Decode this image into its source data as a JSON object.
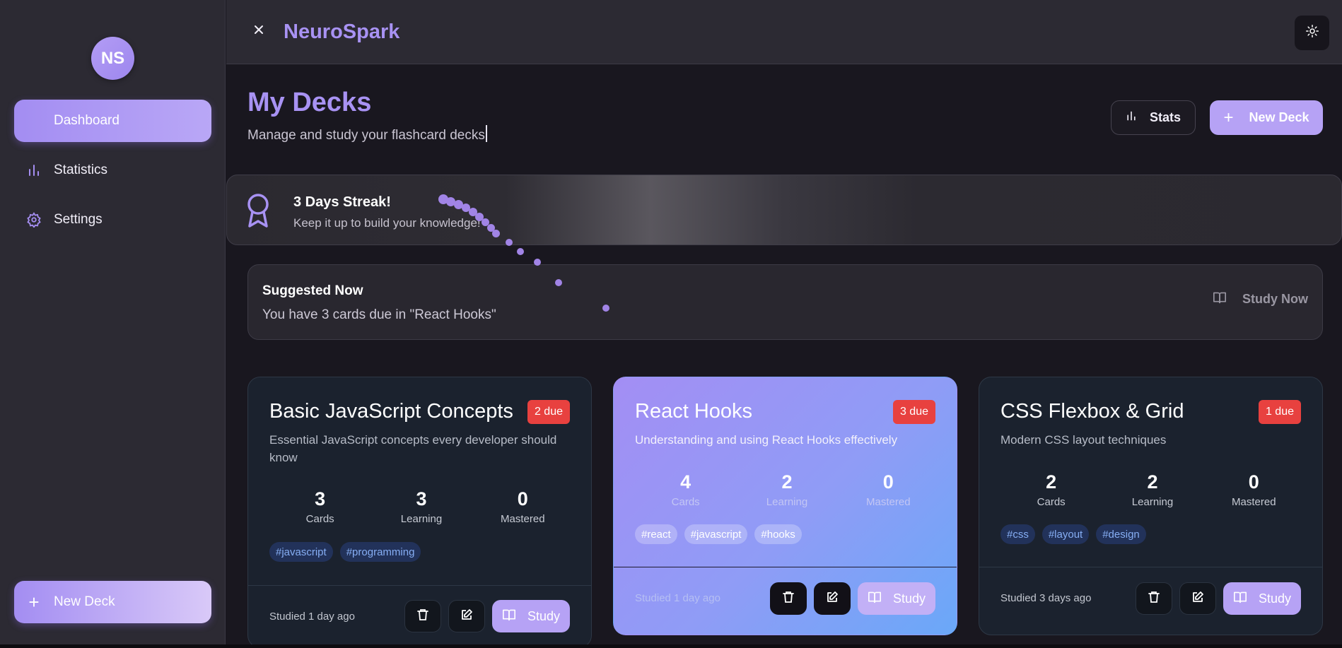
{
  "sidebar": {
    "avatar_initials": "NS",
    "items": [
      {
        "label": "Dashboard",
        "icon": "home-icon"
      },
      {
        "label": "Statistics",
        "icon": "bar-chart-icon"
      },
      {
        "label": "Settings",
        "icon": "gear-icon"
      }
    ],
    "new_deck_label": "New Deck"
  },
  "topbar": {
    "brand": "NeuroSpark",
    "close_icon": "close-icon",
    "theme_icon": "sun-icon"
  },
  "header": {
    "title": "My Decks",
    "subtitle": "Manage and study your flashcard decks",
    "stats_label": "Stats",
    "new_deck_label": "New Deck"
  },
  "streak": {
    "title": "3 Days Streak!",
    "text": "Keep it up to build your knowledge!"
  },
  "suggested": {
    "title": "Suggested Now",
    "text": "You have 3 cards due in \"React Hooks\"",
    "button_label": "Study Now"
  },
  "decks": [
    {
      "title": "Basic JavaScript Concepts",
      "description": "Essential JavaScript concepts every developer should know",
      "due": "2 due",
      "stats": [
        {
          "value": "3",
          "label": "Cards"
        },
        {
          "value": "3",
          "label": "Learning"
        },
        {
          "value": "0",
          "label": "Mastered"
        }
      ],
      "tags": [
        "#javascript",
        "#programming"
      ],
      "studied": "Studied 1 day ago",
      "study_label": "Study"
    },
    {
      "title": "React Hooks",
      "description": "Understanding and using React Hooks effectively",
      "due": "3 due",
      "stats": [
        {
          "value": "4",
          "label": "Cards"
        },
        {
          "value": "2",
          "label": "Learning"
        },
        {
          "value": "0",
          "label": "Mastered"
        }
      ],
      "tags": [
        "#react",
        "#javascript",
        "#hooks"
      ],
      "studied": "Studied 1 day ago",
      "study_label": "Study"
    },
    {
      "title": "CSS Flexbox & Grid",
      "description": "Modern CSS layout techniques",
      "due": "1 due",
      "stats": [
        {
          "value": "2",
          "label": "Cards"
        },
        {
          "value": "2",
          "label": "Learning"
        },
        {
          "value": "0",
          "label": "Mastered"
        }
      ],
      "tags": [
        "#css",
        "#layout",
        "#design"
      ],
      "studied": "Studied 3 days ago",
      "study_label": "Study"
    }
  ],
  "colors": {
    "accent": "#a892f3",
    "due_badge": "#e8413f",
    "background": "#19171f",
    "sidebar": "#2c2a33"
  }
}
